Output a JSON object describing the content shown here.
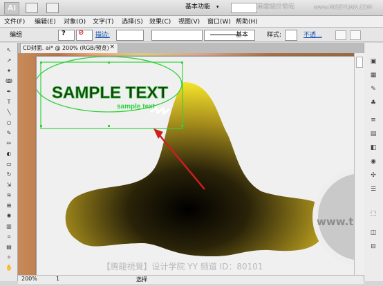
{
  "app": {
    "logo": "Ai",
    "workspace_label": "基本功能",
    "watermark": "思缘设计论坛",
    "site_watermark": "www.MISSYUAN.COM"
  },
  "menus": [
    "文件(F)",
    "编辑(E)",
    "对象(O)",
    "文字(T)",
    "选择(S)",
    "效果(C)",
    "视图(V)",
    "窗口(W)",
    "帮助(H)"
  ],
  "control": {
    "group_label": "编组",
    "stroke_label": "描边:",
    "style_label": "样式:",
    "opacity_label": "不透...",
    "basic_label": "基本"
  },
  "document": {
    "tab_title": "CD封面. ai* @ 200% (RGB/预览)",
    "close_icon": "close-icon"
  },
  "artwork": {
    "sample_text": "SAMPLE TEXT",
    "sample_small": "sample text",
    "url_text": "www.tlvi.net",
    "bottom_watermark": "【腾龍視覺】设计学院   YY 频道 ID：80101"
  },
  "status": {
    "zoom": "200%",
    "page": "1",
    "mode": "选择"
  },
  "colors": {
    "selection": "#35d13c",
    "arrow": "#d01d1d",
    "shape_gold": "#f2e129"
  }
}
